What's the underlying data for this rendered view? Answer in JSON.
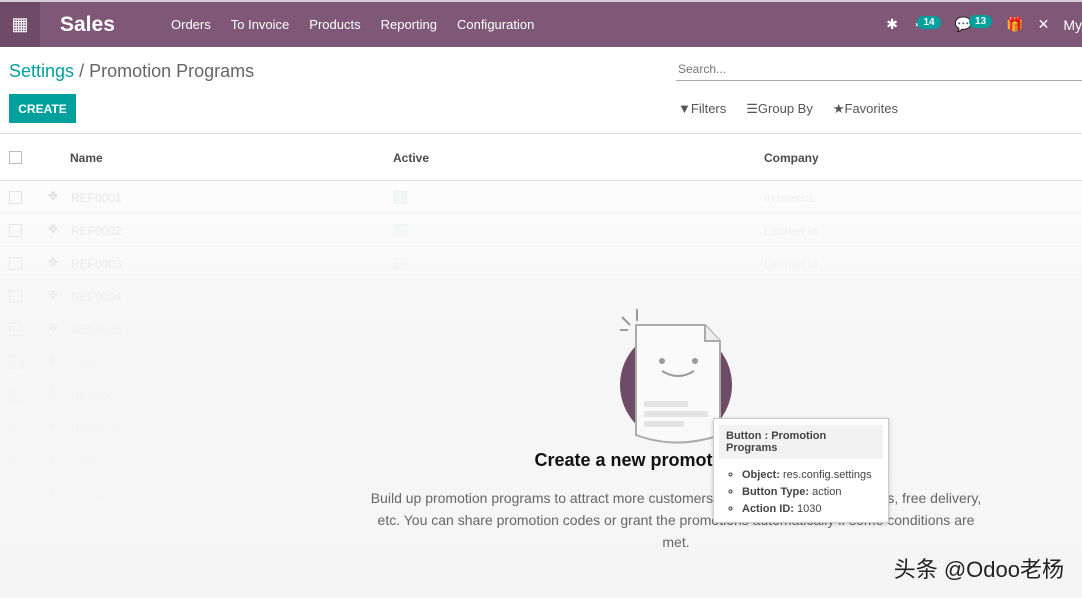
{
  "nav": {
    "app": "Sales",
    "menu": [
      "Orders",
      "To Invoice",
      "Products",
      "Reporting",
      "Configuration"
    ],
    "activity_count": "14",
    "message_count": "13",
    "user": "My"
  },
  "breadcrumb": {
    "parent": "Settings",
    "sep": "/",
    "current": "Promotion Programs"
  },
  "create_label": "CREATE",
  "search": {
    "placeholder": "Search..."
  },
  "filters": {
    "filters": "Filters",
    "group_by": "Group By",
    "favorites": "Favorites"
  },
  "table": {
    "columns": [
      "Name",
      "Active",
      "Company"
    ],
    "rows": [
      {
        "name": "REF0001",
        "company": "In massa"
      },
      {
        "name": "REF0002",
        "company": "Laoreet id"
      },
      {
        "name": "REF0003",
        "company": "Laoreet id"
      },
      {
        "name": "REF0004",
        "company": ""
      },
      {
        "name": "REF0005",
        "company": ""
      },
      {
        "name": "REF0006",
        "company": ""
      },
      {
        "name": "REF0007",
        "company": ""
      },
      {
        "name": "REF0008",
        "company": ""
      },
      {
        "name": "REF0009",
        "company": ""
      },
      {
        "name": "REF0010",
        "company": ""
      }
    ]
  },
  "empty": {
    "title": "Create a new promotion program",
    "description": "Build up promotion programs to attract more customers with discounts, free products, free delivery, etc. You can share promotion codes or grant the promotions automatically if some conditions are met."
  },
  "tooltip": {
    "title": "Button : Promotion Programs",
    "object_label": "Object:",
    "object": "res.config.settings",
    "type_label": "Button Type:",
    "type": "action",
    "action_label": "Action ID:",
    "action": "1030"
  },
  "watermark": "头条 @Odoo老杨",
  "colors": {
    "navbar": "#7f5877",
    "accent": "#00a09d"
  }
}
